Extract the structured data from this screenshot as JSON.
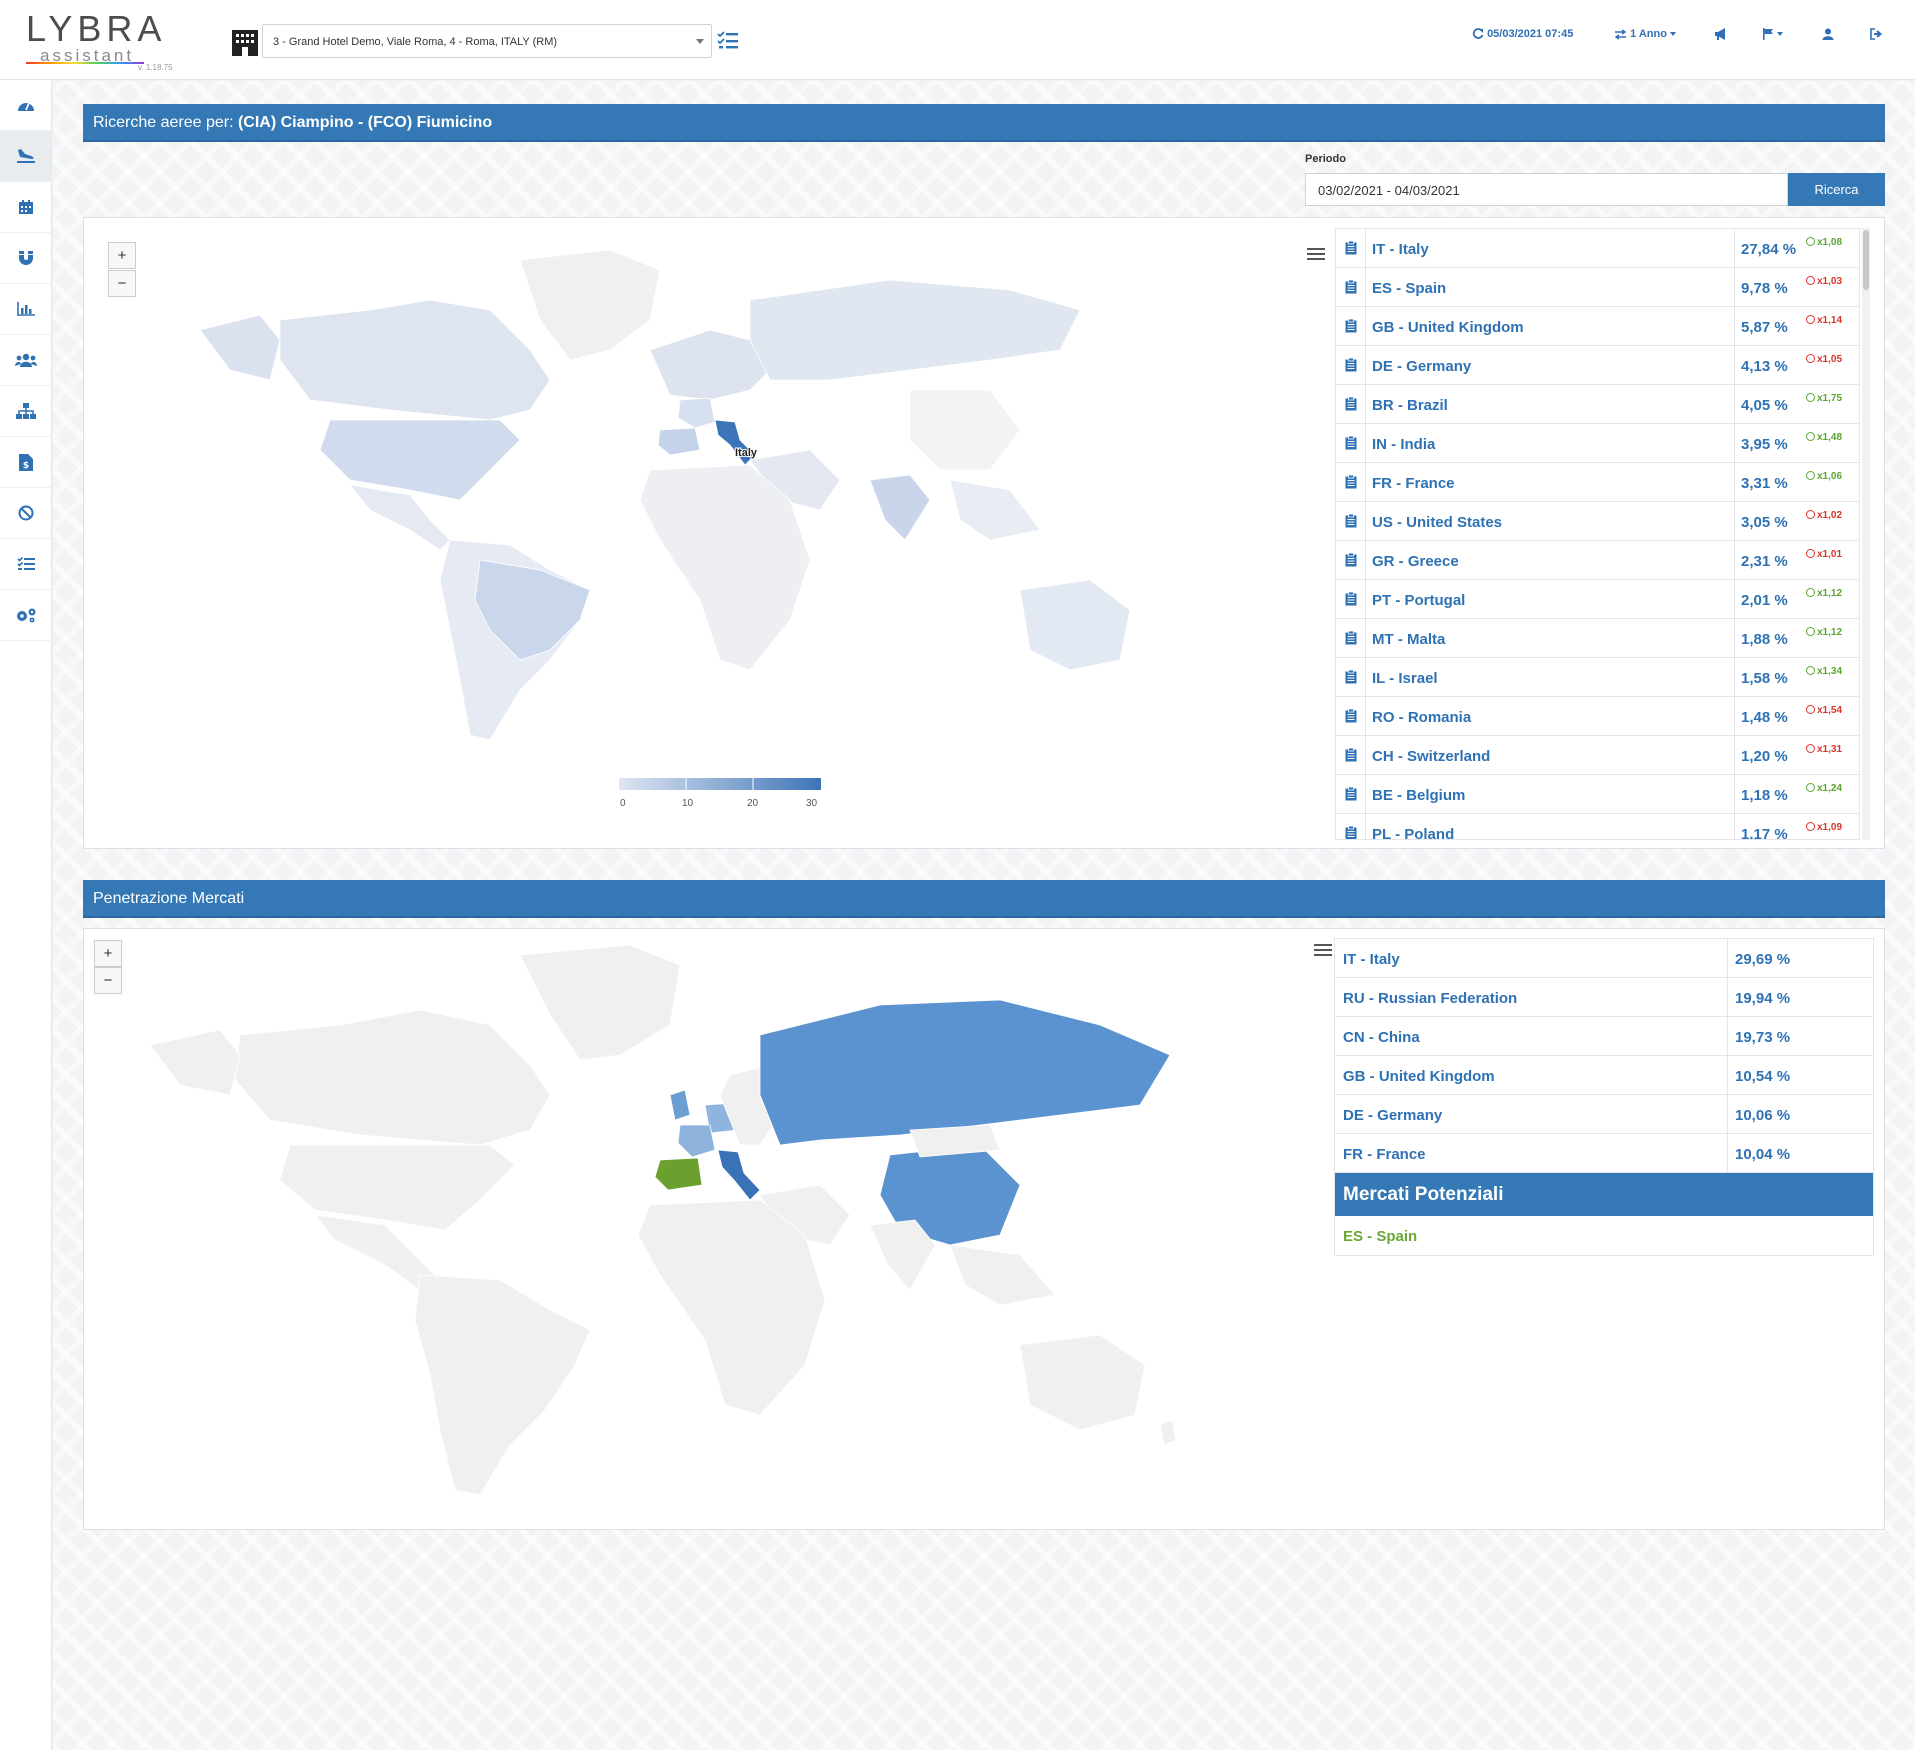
{
  "app": {
    "logo_main": "LYBRA",
    "logo_sub": "assistant",
    "version": "v. 1.18.75"
  },
  "header": {
    "hotel_select_value": "3 - Grand Hotel Demo, Viale Roma, 4 - Roma, ITALY (RM)",
    "datetime": "05/03/2021 07:45",
    "period_menu": "1 Anno"
  },
  "sidebar": {
    "items": [
      {
        "icon": "dashboard-icon"
      },
      {
        "icon": "plane-landing-icon",
        "active": true
      },
      {
        "icon": "calendar-icon"
      },
      {
        "icon": "magnet-icon"
      },
      {
        "icon": "bar-chart-icon"
      },
      {
        "icon": "users-icon"
      },
      {
        "icon": "sitemap-icon"
      },
      {
        "icon": "file-dollar-icon"
      },
      {
        "icon": "ban-icon"
      },
      {
        "icon": "list-check-icon"
      },
      {
        "icon": "cogs-icon"
      }
    ]
  },
  "section1": {
    "title_prefix": "Ricerche aeree per: ",
    "title_airports": "(CIA) Ciampino - (FCO) Fiumicino",
    "period_label": "Periodo",
    "period_value": "03/02/2021 - 04/03/2021",
    "search_button": "Ricerca",
    "map_highlight_label": "Italy",
    "legend_ticks": [
      "0",
      "10",
      "20",
      "30"
    ],
    "countries": [
      {
        "name": "IT - Italy",
        "pct": "27,84 %",
        "delta": "x1,08",
        "trend": "up"
      },
      {
        "name": "ES - Spain",
        "pct": "9,78 %",
        "delta": "x1,03",
        "trend": "down"
      },
      {
        "name": "GB - United Kingdom",
        "pct": "5,87 %",
        "delta": "x1,14",
        "trend": "down"
      },
      {
        "name": "DE - Germany",
        "pct": "4,13 %",
        "delta": "x1,05",
        "trend": "down"
      },
      {
        "name": "BR - Brazil",
        "pct": "4,05 %",
        "delta": "x1,75",
        "trend": "up"
      },
      {
        "name": "IN - India",
        "pct": "3,95 %",
        "delta": "x1,48",
        "trend": "up"
      },
      {
        "name": "FR - France",
        "pct": "3,31 %",
        "delta": "x1,06",
        "trend": "up"
      },
      {
        "name": "US - United States",
        "pct": "3,05 %",
        "delta": "x1,02",
        "trend": "down"
      },
      {
        "name": "GR - Greece",
        "pct": "2,31 %",
        "delta": "x1,01",
        "trend": "down"
      },
      {
        "name": "PT - Portugal",
        "pct": "2,01 %",
        "delta": "x1,12",
        "trend": "up"
      },
      {
        "name": "MT - Malta",
        "pct": "1,88 %",
        "delta": "x1,12",
        "trend": "up"
      },
      {
        "name": "IL - Israel",
        "pct": "1,58 %",
        "delta": "x1,34",
        "trend": "up"
      },
      {
        "name": "RO - Romania",
        "pct": "1,48 %",
        "delta": "x1,54",
        "trend": "down"
      },
      {
        "name": "CH - Switzerland",
        "pct": "1,20 %",
        "delta": "x1,31",
        "trend": "down"
      },
      {
        "name": "BE - Belgium",
        "pct": "1,18 %",
        "delta": "x1,24",
        "trend": "up"
      },
      {
        "name": "PL - Poland",
        "pct": "1,17 %",
        "delta": "x1,09",
        "trend": "down"
      }
    ]
  },
  "section2": {
    "title": "Penetrazione Mercati",
    "markets": [
      {
        "name": "IT - Italy",
        "pct": "29,69 %"
      },
      {
        "name": "RU - Russian Federation",
        "pct": "19,94 %"
      },
      {
        "name": "CN - China",
        "pct": "19,73 %"
      },
      {
        "name": "GB - United Kingdom",
        "pct": "10,54 %"
      },
      {
        "name": "DE - Germany",
        "pct": "10,06 %"
      },
      {
        "name": "FR - France",
        "pct": "10,04 %"
      }
    ],
    "potential_title": "Mercati Potenziali",
    "potential_markets": [
      "ES - Spain"
    ]
  },
  "colors": {
    "primary": "#3479b6",
    "link": "#2f72b4",
    "up": "#59a62c",
    "down": "#d9342b",
    "potential": "#6aa833"
  }
}
